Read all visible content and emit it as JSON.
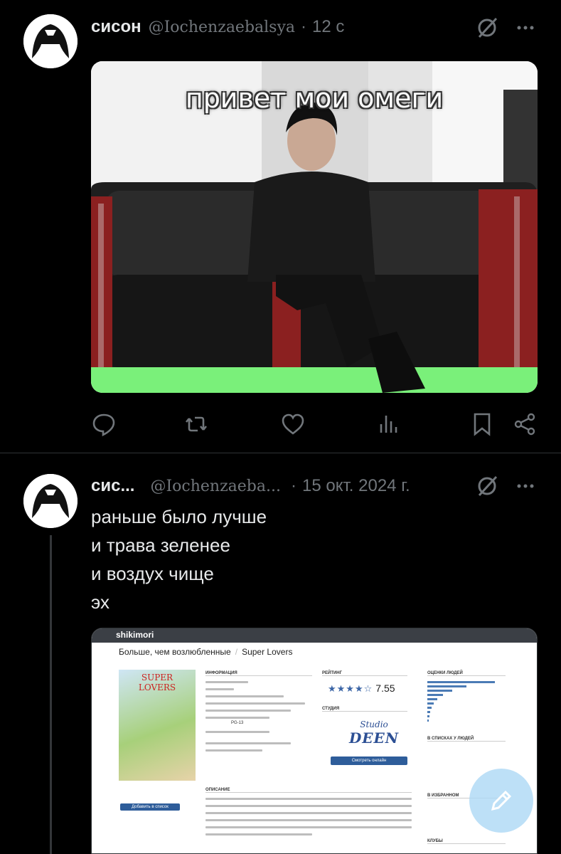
{
  "post1": {
    "name": "сисон",
    "handle": "@Iochenzaebalsya",
    "time": "12 с",
    "image_caption": "привет мои омеги"
  },
  "post2": {
    "name": "сис...",
    "handle": "@Iochenzaeba...",
    "time": "15 окт. 2024 г.",
    "text_lines": [
      "раньше было лучше",
      "и трава зеленее",
      "и воздух чище",
      "эх"
    ]
  },
  "shikimori": {
    "logo": "shikimori",
    "title": "Больше, чем возлюбленные",
    "title_en": "Super Lovers",
    "cover_title": "SUPER LOVERS",
    "section_info": "ИНФОРМАЦИЯ",
    "section_rating": "РЕЙТИНГ",
    "section_studio": "СТУДИЯ",
    "section_scores": "ОЦЕНКИ ЛЮДЕЙ",
    "section_description": "ОПИСАНИЕ",
    "section_lists": "В СПИСКАХ У ЛЮДЕЙ",
    "section_favorites": "В ИЗБРАННОМ",
    "section_clubs": "КЛУБЫ",
    "stars": "★★★★☆",
    "score": "7.55",
    "rating_label": "PG-13",
    "studio_line1": "Studio",
    "studio_line2": "DEEN",
    "watch_button": "Смотреть онлайн",
    "add_button": "Добавить в список",
    "score_bars": [
      0.95,
      0.55,
      0.35,
      0.22,
      0.14,
      0.09,
      0.06,
      0.04,
      0.03,
      0.02
    ]
  },
  "icons": {
    "reply": "reply-icon",
    "retweet": "retweet-icon",
    "like": "heart-icon",
    "views": "views-icon",
    "bookmark": "bookmark-icon",
    "share": "share-icon",
    "grok": "grok-icon",
    "more": "more-icon",
    "compose": "compose-icon"
  },
  "colors": {
    "background": "#000000",
    "text": "#e7e9ea",
    "secondary": "#71767b",
    "divider": "#2f3336",
    "fab": "#add8f5"
  }
}
